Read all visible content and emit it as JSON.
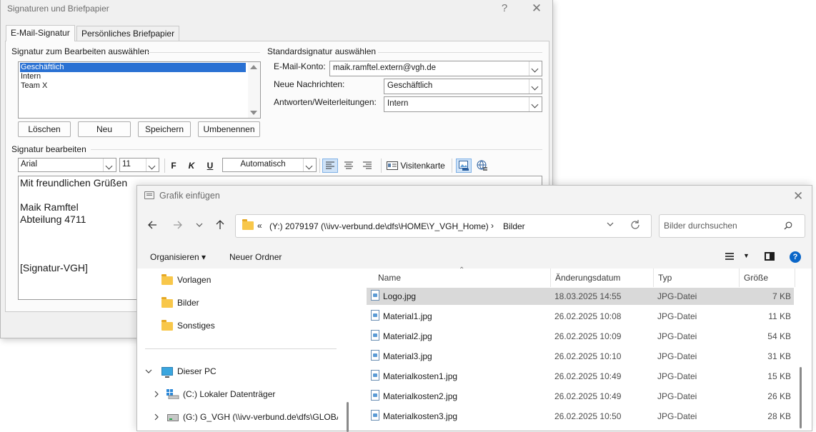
{
  "signature_dialog": {
    "title": "Signaturen und Briefpapier",
    "help": "?",
    "close": "✕",
    "tabs": [
      "E-Mail-Signatur",
      "Persönliches Briefpapier"
    ],
    "select_group_label": "Signatur zum Bearbeiten auswählen",
    "signatures": [
      "Geschäftlich",
      "Intern",
      "Team X"
    ],
    "selected_signature": "Geschäftlich",
    "buttons": {
      "delete": "Löschen",
      "new": "Neu",
      "save": "Speichern",
      "rename": "Umbenennen"
    },
    "default_group_label": "Standardsignatur auswählen",
    "account_label": "E-Mail-Konto:",
    "account_value": "maik.ramftel.extern@vgh.de",
    "new_messages_label": "Neue Nachrichten:",
    "new_messages_value": "Geschäftlich",
    "replies_label": "Antworten/Weiterleitungen:",
    "replies_value": "Intern",
    "edit_group_label": "Signatur bearbeiten",
    "toolbar": {
      "font": "Arial",
      "size": "11",
      "bold": "F",
      "italic": "K",
      "underline": "U",
      "color": "Automatisch",
      "business_card": "Visitenkarte"
    },
    "editor_lines": [
      "Mit freundlichen Grüßen",
      "",
      "Maik Ramftel",
      "Abteilung 4711",
      "",
      "",
      "",
      "[Signatur-VGH]"
    ]
  },
  "file_dialog": {
    "title": "Grafik einfügen",
    "close": "✕",
    "address_prefix": "«",
    "address_path": "(Y:) 2079197 (\\\\ivv-verbund.de\\dfs\\HOME\\Y_VGH_Home)",
    "address_separator": "›",
    "address_current": "Bilder",
    "search_placeholder": "Bilder durchsuchen",
    "organize": "Organisieren ▾",
    "new_folder": "Neuer Ordner",
    "help": "?",
    "nav_items": {
      "vorlagen": "Vorlagen",
      "bilder": "Bilder",
      "sonstiges": "Sonstiges",
      "this_pc": "Dieser PC",
      "drive_c": "(C:) Lokaler Datenträger",
      "drive_g": "(G:) G_VGH (\\\\ivv-verbund.de\\dfs\\GLOBAL"
    },
    "columns": {
      "name": "Name",
      "date": "Änderungsdatum",
      "type": "Typ",
      "size": "Größe"
    },
    "files": [
      {
        "name": "Logo.jpg",
        "date": "18.03.2025 14:55",
        "type": "JPG-Datei",
        "size": "7 KB"
      },
      {
        "name": "Material1.jpg",
        "date": "26.02.2025 10:08",
        "type": "JPG-Datei",
        "size": "11 KB"
      },
      {
        "name": "Material2.jpg",
        "date": "26.02.2025 10:09",
        "type": "JPG-Datei",
        "size": "54 KB"
      },
      {
        "name": "Material3.jpg",
        "date": "26.02.2025 10:10",
        "type": "JPG-Datei",
        "size": "31 KB"
      },
      {
        "name": "Materialkosten1.jpg",
        "date": "26.02.2025 10:49",
        "type": "JPG-Datei",
        "size": "15 KB"
      },
      {
        "name": "Materialkosten2.jpg",
        "date": "26.02.2025 10:49",
        "type": "JPG-Datei",
        "size": "26 KB"
      },
      {
        "name": "Materialkosten3.jpg",
        "date": "26.02.2025 10:50",
        "type": "JPG-Datei",
        "size": "28 KB"
      }
    ],
    "selected_file": "Logo.jpg"
  },
  "colors": {
    "selection_blue": "#2a71d3",
    "folder_yellow": "#f8c74a",
    "help_blue": "#0a66c8",
    "row_selected": "#d9d9d9"
  }
}
